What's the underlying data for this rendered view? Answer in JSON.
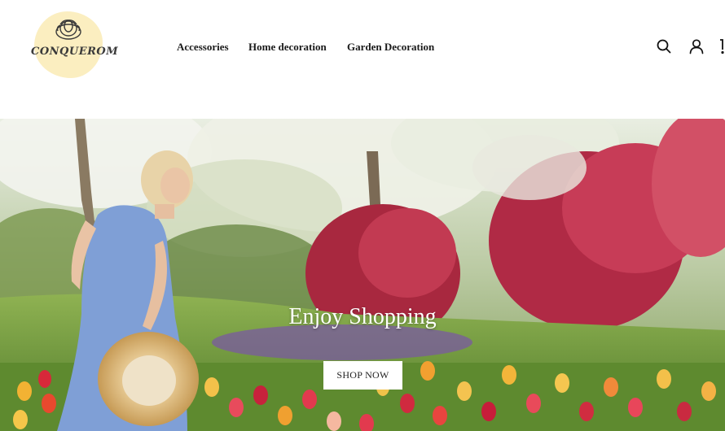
{
  "brand": {
    "name": "CONQUEROM",
    "logo_icon": "flower-icon",
    "logo_bg_color": "#fbeec0"
  },
  "nav": {
    "items": [
      {
        "label": "Accessories"
      },
      {
        "label": "Home decoration"
      },
      {
        "label": "Garden Decoration"
      }
    ]
  },
  "header_icons": {
    "search": "search-icon",
    "account": "user-icon",
    "cart": "cart-icon"
  },
  "hero": {
    "title": "Enjoy Shopping",
    "button_label": "SHOP NOW",
    "image_subject": "woman with straw hat walking in tulip garden"
  }
}
